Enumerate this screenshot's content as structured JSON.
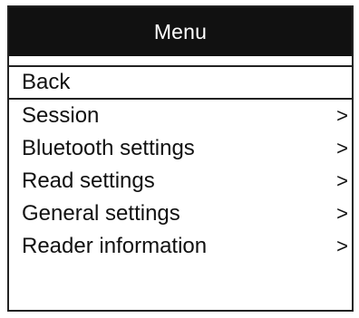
{
  "title": "Menu",
  "menu": {
    "items": [
      {
        "label": "Back",
        "arrow": ""
      },
      {
        "label": "Session",
        "arrow": ">"
      },
      {
        "label": "Bluetooth settings",
        "arrow": ">"
      },
      {
        "label": "Read settings",
        "arrow": ">"
      },
      {
        "label": "General settings",
        "arrow": ">"
      },
      {
        "label": "Reader information",
        "arrow": ">"
      }
    ]
  }
}
